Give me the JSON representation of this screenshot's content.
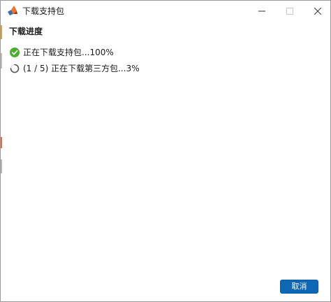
{
  "window": {
    "title": "下载支持包",
    "controls": {
      "minimize": "minimize-icon",
      "maximize": "maximize-icon",
      "close": "close-icon"
    }
  },
  "content": {
    "section_title": "下载进度",
    "tasks": [
      {
        "status": "complete",
        "icon": "check-circle-icon",
        "text": "正在下载支持包...100%"
      },
      {
        "status": "in-progress",
        "icon": "spinner-icon",
        "text": "(1 / 5) 正在下载第三方包...3%"
      }
    ]
  },
  "footer": {
    "cancel_label": "取消"
  },
  "colors": {
    "accent": "#0e67b5",
    "success": "#4cae2e",
    "spinner": "#555555"
  }
}
